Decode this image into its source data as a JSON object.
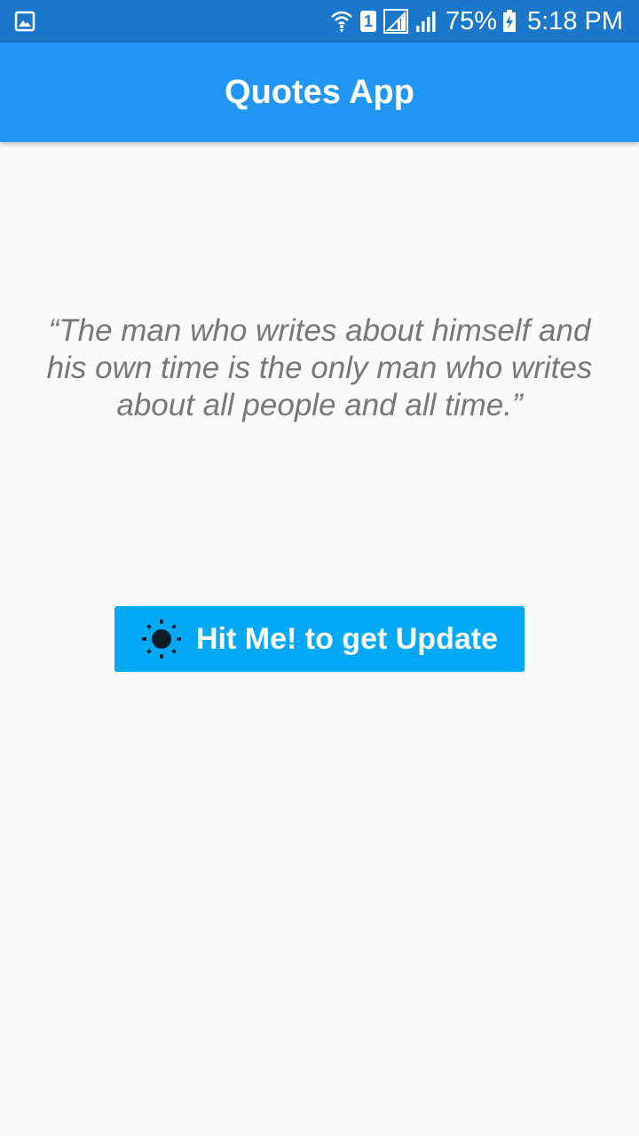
{
  "status_bar": {
    "left_icon": "gallery-icon",
    "icons": [
      "wifi-icon",
      "sim-1-icon",
      "signal-icon",
      "signal-icon"
    ],
    "sim_number": "1",
    "battery_percent": "75%",
    "battery_icon": "battery-charging-icon",
    "time": "5:18 PM"
  },
  "app_bar": {
    "title": "Quotes App"
  },
  "quote": {
    "text": "“The man who writes about himself and his own time is the only man who writes about all people and all time.”"
  },
  "update_button": {
    "icon": "sun-icon",
    "label": "Hit Me! to get Update"
  },
  "colors": {
    "status_bar": "#1a77c9",
    "app_bar": "#2196f3",
    "button": "#03a9f4",
    "background": "#fafafa",
    "quote_text": "#777777"
  }
}
